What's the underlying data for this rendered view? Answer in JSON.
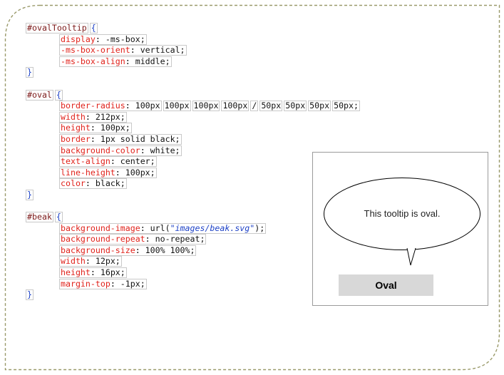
{
  "code": {
    "ovalTooltip": {
      "selector": "#ovalTooltip",
      "open": "{",
      "close": "}",
      "decls": [
        {
          "prop": "display",
          "value": "-ms-box;"
        },
        {
          "prop": "-ms-box-orient",
          "value": "vertical;"
        },
        {
          "prop": "-ms-box-align",
          "value": "middle;"
        }
      ]
    },
    "oval": {
      "selector": "#oval",
      "open": "{",
      "close": "}",
      "radius_prop": "border-radius",
      "radius_tokens": [
        "100px",
        "100px",
        "100px",
        "100px",
        "/",
        "50px",
        "50px",
        "50px",
        "50px;"
      ],
      "decls": [
        {
          "prop": "width",
          "value": "212px;"
        },
        {
          "prop": "height",
          "value": "100px;"
        },
        {
          "prop": "border",
          "value": "1px solid black;"
        },
        {
          "prop": "background-color",
          "value": "white;"
        },
        {
          "prop": "text-align",
          "value": "center;"
        },
        {
          "prop": "line-height",
          "value": "100px;"
        },
        {
          "prop": "color",
          "value": "black;"
        }
      ]
    },
    "beak": {
      "selector": "#beak",
      "open": "{",
      "close": "}",
      "bg_image_prop": "background-image",
      "bg_image_url_fn": "url(",
      "bg_image_url": "\"images/beak.svg\"",
      "bg_image_url_end": ");",
      "decls": [
        {
          "prop": "background-repeat",
          "value": "no-repeat;"
        },
        {
          "prop": "background-size",
          "value": "100% 100%;"
        },
        {
          "prop": "width",
          "value": "12px;"
        },
        {
          "prop": "height",
          "value": "16px;"
        },
        {
          "prop": "margin-top",
          "value": "-1px;"
        }
      ]
    }
  },
  "preview": {
    "tooltip_text": "This tooltip is oval.",
    "button_label": "Oval"
  },
  "colors": {
    "property": "#e0221b",
    "brace": "#1f43c7",
    "selector": "#7c1a1a",
    "frame_dash": "#9a9a6a",
    "button_bg": "#d8d8d8"
  }
}
